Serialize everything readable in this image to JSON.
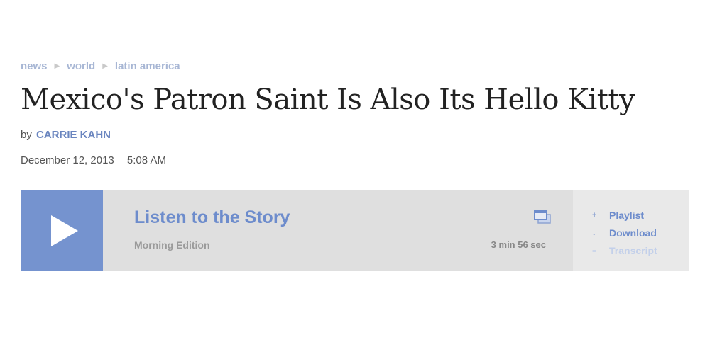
{
  "breadcrumb": {
    "items": [
      "news",
      "world",
      "latin america"
    ],
    "separator": "▶"
  },
  "article": {
    "title": "Mexico's Patron Saint Is Also Its Hello Kitty",
    "by_prefix": "by",
    "author": "CARRIE KAHN",
    "date": "December 12, 2013",
    "time": "5:08 AM"
  },
  "player": {
    "listen_label": "Listen to the Story",
    "program": "Morning Edition",
    "duration": "3 min 56 sec",
    "actions": [
      {
        "label": "Playlist",
        "icon": "plus-icon",
        "glyph": "+"
      },
      {
        "label": "Download",
        "icon": "download-arrow-icon",
        "glyph": "↓"
      },
      {
        "label": "Transcript",
        "icon": "list-icon",
        "glyph": "≡"
      }
    ],
    "colors": {
      "accent": "#7593cf",
      "link": "#6d8ccc",
      "panel": "#dfdfdf",
      "side_panel": "#e9e9e9"
    }
  }
}
